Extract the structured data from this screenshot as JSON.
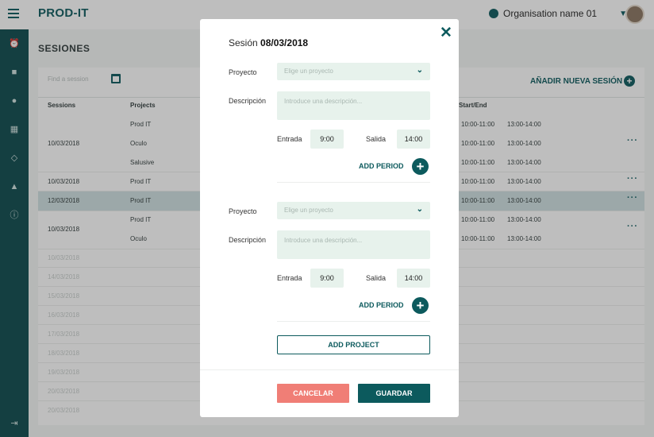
{
  "app": {
    "logo": "PROD-IT"
  },
  "header": {
    "organisation": "Organisation name 01"
  },
  "page": {
    "title": "SESIONES"
  },
  "toolbar": {
    "search_placeholder": "Find a session",
    "add_session_label": "AÑADIR NUEVA SESIÓN"
  },
  "table": {
    "headers": {
      "sessions": "Sessions",
      "projects": "Projects",
      "start_end": "Start/End"
    },
    "rows": [
      {
        "date": "10/03/2018",
        "projects": [
          "Prod IT",
          "Oculo",
          "Salusive"
        ],
        "periods": [
          [
            "10:00-11:00",
            "13:00-14:00"
          ],
          [
            "10:00-11:00",
            "13:00-14:00"
          ],
          [
            "10:00-11:00",
            "13:00-14:00"
          ]
        ]
      },
      {
        "date": "10/03/2018",
        "projects": [
          "Prod IT"
        ],
        "periods": [
          [
            "10:00-11:00",
            "13:00-14:00"
          ]
        ]
      },
      {
        "date": "12/03/2018",
        "projects": [
          "Prod IT"
        ],
        "periods": [
          [
            "10:00-11:00",
            "13:00-14:00"
          ]
        ]
      },
      {
        "date": "10/03/2018",
        "projects": [
          "Prod IT",
          "Oculo"
        ],
        "periods": [
          [
            "10:00-11:00",
            "13:00-14:00"
          ],
          [
            "10:00-11:00",
            "13:00-14:00"
          ]
        ]
      }
    ],
    "faded_dates": [
      "10/03/2018",
      "14/03/2018",
      "15/03/2018",
      "16/03/2018",
      "17/03/2018",
      "18/03/2018",
      "19/03/2018",
      "20/03/2018",
      "20/03/2018"
    ]
  },
  "modal": {
    "title_prefix": "Sesión ",
    "title_date": "08/03/2018",
    "blocks": [
      {
        "project_label": "Proyecto",
        "project_placeholder": "Elige un proyecto",
        "desc_label": "Descripción",
        "desc_placeholder": "Introduce una descripción...",
        "entry_label": "Entrada",
        "entry_value": "9:00",
        "exit_label": "Salida",
        "exit_value": "14:00",
        "add_period_label": "ADD PERIOD"
      },
      {
        "project_label": "Proyecto",
        "project_placeholder": "Elige un proyecto",
        "desc_label": "Descripción",
        "desc_placeholder": "Introduce una descripción...",
        "entry_label": "Entrada",
        "entry_value": "9:00",
        "exit_label": "Salida",
        "exit_value": "14:00",
        "add_period_label": "ADD PERIOD"
      }
    ],
    "add_project_label": "ADD PROJECT",
    "cancel_label": "CANCELAR",
    "save_label": "GUARDAR"
  },
  "colors": {
    "primary": "#0c5a5d",
    "danger": "#f07e76",
    "input_bg": "#e7f2ec"
  }
}
